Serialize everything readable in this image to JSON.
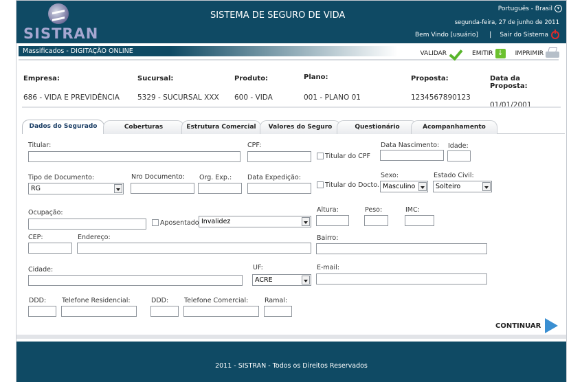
{
  "header": {
    "logo_text": "SISTRAN",
    "title": "SISTEMA DE SEGURO DE VIDA",
    "language": "Português - Brasil",
    "date": "segunda-feira, 27 de junho de 2011",
    "welcome": "Bem Vindo [usuário]",
    "separator": "|",
    "logout": "Sair do Sistema"
  },
  "breadcrumb": "Massificados - DIGITAÇÃO ONLINE",
  "actions": {
    "validar": "VALIDAR",
    "emitir": "EMITIR",
    "imprimir": "IMPRIMIR"
  },
  "info": {
    "empresa": {
      "label": "Empresa:",
      "value": "686 - VIDA E PREVIDÊNCIA"
    },
    "sucursal": {
      "label": "Sucursal:",
      "value": "5329 - SUCURSAL XXX"
    },
    "produto": {
      "label": "Produto:",
      "value": "600 - VIDA"
    },
    "plano": {
      "label": "Plano:",
      "value": "001 - PLANO 01"
    },
    "proposta": {
      "label": "Proposta:",
      "value": "1234567890123"
    },
    "data_proposta": {
      "label": "Data da Proposta:",
      "value": "01/01/2001"
    }
  },
  "tabs": [
    "Dados do Segurado",
    "Coberturas",
    "Estrutura Comercial",
    "Valores do Seguro",
    "Questionário",
    "Acompanhamento"
  ],
  "form": {
    "titular": "Titular:",
    "cpf": "CPF:",
    "titular_cpf": "Titular do CPF",
    "data_nascimento": "Data Nascimento:",
    "idade": "Idade:",
    "tipo_documento": "Tipo de Documento:",
    "tipo_documento_value": "RG",
    "nro_documento": "Nro Documento:",
    "org_exp": "Org. Exp.:",
    "data_expedicao": "Data Expedição:",
    "titular_docto": "Titular do Docto.",
    "sexo": "Sexo:",
    "sexo_value": "Masculino",
    "estado_civil": "Estado Civil:",
    "estado_civil_value": "Solteiro",
    "ocupacao": "Ocupação:",
    "aposentado": "Aposentado",
    "aposentado_value": "Invalidez",
    "altura": "Altura:",
    "peso": "Peso:",
    "imc": "IMC:",
    "cep": "CEP:",
    "endereco": "Endereço:",
    "bairro": "Bairro:",
    "cidade": "Cidade:",
    "uf": "UF:",
    "uf_value": "ACRE",
    "email": "E-mail:",
    "ddd1": "DDD:",
    "tel_residencial": "Telefone Residencial:",
    "ddd2": "DDD:",
    "tel_comercial": "Telefone Comercial:",
    "ramal": "Ramal:"
  },
  "continuar": "CONTINUAR",
  "footer": "2011 - SISTRAN - Todos os Direitos Reservados",
  "colors": {
    "brand": "#0f4a64",
    "accent_blue": "#3a8fd2",
    "ok_green": "#58b52a",
    "logout_red": "#e02a2a"
  }
}
